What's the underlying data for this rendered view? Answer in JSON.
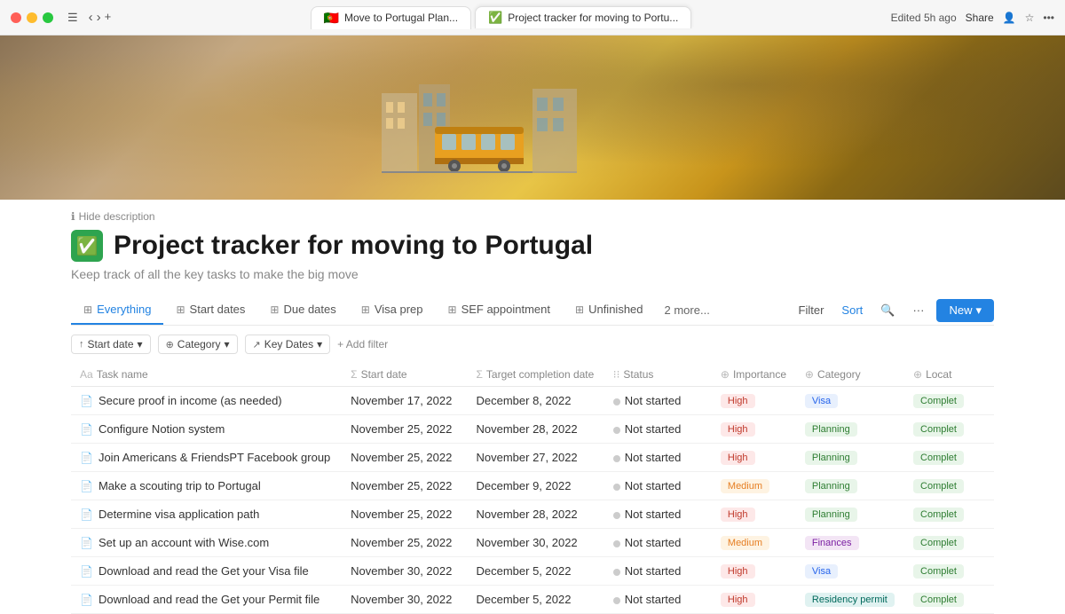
{
  "titlebar": {
    "edited": "Edited 5h ago",
    "share": "Share",
    "tab1": "Move to Portugal Plan...",
    "tab2": "Project tracker for moving to Portu...",
    "tab1_flag": "🇵🇹",
    "tab2_check": "✅"
  },
  "page": {
    "hide_description": "Hide description",
    "title": "Project tracker for moving to Portugal",
    "subtitle": "Keep track of all the key tasks to make the big move",
    "icon": "✅"
  },
  "tabs": [
    {
      "id": "everything",
      "label": "Everything",
      "icon": "⊞",
      "active": true
    },
    {
      "id": "start-dates",
      "label": "Start dates",
      "icon": "⊞"
    },
    {
      "id": "due-dates",
      "label": "Due dates",
      "icon": "⊞"
    },
    {
      "id": "visa-prep",
      "label": "Visa prep",
      "icon": "⊞"
    },
    {
      "id": "sef-appointment",
      "label": "SEF appointment",
      "icon": "⊞"
    },
    {
      "id": "unfinished",
      "label": "Unfinished",
      "icon": "⊞"
    },
    {
      "id": "more",
      "label": "2 more..."
    }
  ],
  "toolbar": {
    "filter": "Filter",
    "sort": "Sort",
    "new": "New"
  },
  "filters": [
    {
      "label": "Start date",
      "icon": "↑"
    },
    {
      "label": "Category",
      "icon": "⊕"
    },
    {
      "label": "Key Dates",
      "icon": "↗"
    }
  ],
  "add_filter": "+ Add filter",
  "columns": [
    {
      "label": "Task name",
      "icon": "Aa"
    },
    {
      "label": "Start date",
      "icon": "Σ"
    },
    {
      "label": "Target completion date",
      "icon": "Σ"
    },
    {
      "label": "Status",
      "icon": "⁝⁝"
    },
    {
      "label": "Importance",
      "icon": "⊕"
    },
    {
      "label": "Category",
      "icon": "⊕"
    },
    {
      "label": "Locat",
      "icon": "⊕"
    }
  ],
  "rows": [
    {
      "name": "Secure proof in income (as needed)",
      "start": "November 17, 2022",
      "target": "December 8, 2022",
      "status": "Not started",
      "importance": "High",
      "importance_class": "badge-high",
      "category": "Visa",
      "category_class": "badge-visa",
      "location": "Complet"
    },
    {
      "name": "Configure Notion system",
      "start": "November 25, 2022",
      "target": "November 28, 2022",
      "status": "Not started",
      "importance": "High",
      "importance_class": "badge-high",
      "category": "Planning",
      "category_class": "badge-planning",
      "location": "Complet"
    },
    {
      "name": "Join Americans & FriendsPT Facebook group",
      "start": "November 25, 2022",
      "target": "November 27, 2022",
      "status": "Not started",
      "importance": "High",
      "importance_class": "badge-high",
      "category": "Planning",
      "category_class": "badge-planning",
      "location": "Complet"
    },
    {
      "name": "Make a scouting trip to Portugal",
      "start": "November 25, 2022",
      "target": "December 9, 2022",
      "status": "Not started",
      "importance": "Medium",
      "importance_class": "badge-medium",
      "category": "Planning",
      "category_class": "badge-planning",
      "location": "Complet"
    },
    {
      "name": "Determine visa application path",
      "start": "November 25, 2022",
      "target": "November 28, 2022",
      "status": "Not started",
      "importance": "High",
      "importance_class": "badge-high",
      "category": "Planning",
      "category_class": "badge-planning",
      "location": "Complet"
    },
    {
      "name": "Set up an account with Wise.com",
      "start": "November 25, 2022",
      "target": "November 30, 2022",
      "status": "Not started",
      "importance": "Medium",
      "importance_class": "badge-medium",
      "category": "Finances",
      "category_class": "badge-finances",
      "location": "Complet"
    },
    {
      "name": "Download and read the Get your Visa file",
      "start": "November 30, 2022",
      "target": "December 5, 2022",
      "status": "Not started",
      "importance": "High",
      "importance_class": "badge-high",
      "category": "Visa",
      "category_class": "badge-visa",
      "location": "Complet"
    },
    {
      "name": "Download and read the Get your Permit file",
      "start": "November 30, 2022",
      "target": "December 5, 2022",
      "status": "Not started",
      "importance": "High",
      "importance_class": "badge-high",
      "category": "Residency permit",
      "category_class": "badge-residency",
      "location": "Complet"
    }
  ]
}
